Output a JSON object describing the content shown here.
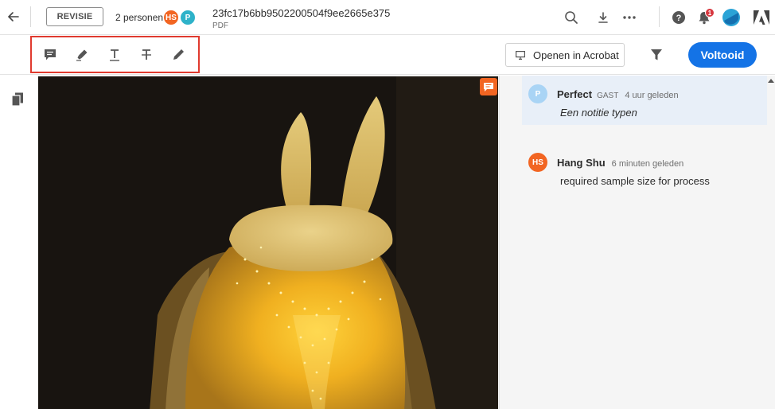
{
  "topbar": {
    "revisie_label": "REVISIE",
    "people_count": "2 personen",
    "avatars": [
      {
        "initials": "HS",
        "color": "#f26522"
      },
      {
        "initials": "P",
        "color": "#2eb2c9"
      }
    ],
    "doc_title": "23fc17b6bb9502200504f9ee2665e375",
    "doc_type": "PDF",
    "notification_count": "1",
    "icons": [
      "back-arrow-icon",
      "search-icon",
      "download-icon",
      "more-icon",
      "help-icon",
      "bell-icon",
      "profile-avatar",
      "adobe-logo-icon"
    ]
  },
  "toolbar": {
    "tools": [
      "comment-tool-icon",
      "highlight-tool-icon",
      "text-underline-tool-icon",
      "strikethrough-tool-icon",
      "draw-tool-icon"
    ],
    "open_acrobat_label": "Openen in Acrobat",
    "done_label": "Voltooid"
  },
  "comments": [
    {
      "initials": "P",
      "avatar_color": "#a9d4f5",
      "name": "Perfect",
      "role": "GAST",
      "time": "4 uur geleden",
      "body": "Een notitie typen",
      "active": true
    },
    {
      "initials": "HS",
      "avatar_color": "#f26522",
      "name": "Hang Shu",
      "role": "",
      "time": "6 minuten geleden",
      "body": "required sample size for process",
      "active": false
    }
  ],
  "colors": {
    "accent_blue": "#1473e6",
    "highlight_box": "#e03a2f",
    "comment_pin": "#f26522"
  }
}
